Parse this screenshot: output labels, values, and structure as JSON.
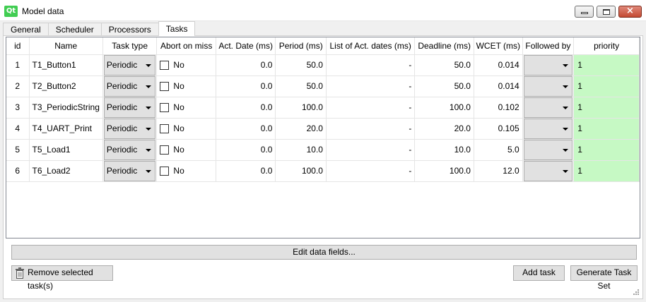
{
  "window": {
    "title": "Model data",
    "logo_text": "Qt",
    "close_glyph": "×"
  },
  "tabs": [
    {
      "label": "General"
    },
    {
      "label": "Scheduler"
    },
    {
      "label": "Processors"
    },
    {
      "label": "Tasks",
      "active": true
    }
  ],
  "table": {
    "columns": [
      "id",
      "Name",
      "Task type",
      "Abort on miss",
      "Act. Date (ms)",
      "Period (ms)",
      "List of Act. dates (ms)",
      "Deadline (ms)",
      "WCET (ms)",
      "Followed by",
      "priority"
    ],
    "rows": [
      {
        "id": "1",
        "name": "T1_Button1",
        "task_type": "Periodic",
        "abort": "No",
        "act_date": "0.0",
        "period": "50.0",
        "act_dates": "-",
        "deadline": "50.0",
        "wcet": "0.014",
        "followed_by": "",
        "priority": "1"
      },
      {
        "id": "2",
        "name": "T2_Button2",
        "task_type": "Periodic",
        "abort": "No",
        "act_date": "0.0",
        "period": "50.0",
        "act_dates": "-",
        "deadline": "50.0",
        "wcet": "0.014",
        "followed_by": "",
        "priority": "1"
      },
      {
        "id": "3",
        "name": "T3_PeriodicString",
        "task_type": "Periodic",
        "abort": "No",
        "act_date": "0.0",
        "period": "100.0",
        "act_dates": "-",
        "deadline": "100.0",
        "wcet": "0.102",
        "followed_by": "",
        "priority": "1"
      },
      {
        "id": "4",
        "name": "T4_UART_Print",
        "task_type": "Periodic",
        "abort": "No",
        "act_date": "0.0",
        "period": "20.0",
        "act_dates": "-",
        "deadline": "20.0",
        "wcet": "0.105",
        "followed_by": "",
        "priority": "1"
      },
      {
        "id": "5",
        "name": "T5_Load1",
        "task_type": "Periodic",
        "abort": "No",
        "act_date": "0.0",
        "period": "10.0",
        "act_dates": "-",
        "deadline": "10.0",
        "wcet": "5.0",
        "followed_by": "",
        "priority": "1"
      },
      {
        "id": "6",
        "name": "T6_Load2",
        "task_type": "Periodic",
        "abort": "No",
        "act_date": "0.0",
        "period": "100.0",
        "act_dates": "-",
        "deadline": "100.0",
        "wcet": "12.0",
        "followed_by": "",
        "priority": "1"
      }
    ]
  },
  "buttons": {
    "edit_fields": "Edit data fields...",
    "remove_selected": "Remove selected task(s)",
    "add_task": "Add task",
    "generate_task_set": "Generate Task Set"
  },
  "colors": {
    "priority_bg": "#c6f9c4",
    "close_button": "#c44a32",
    "qt_logo": "#41cd52"
  },
  "icons": [
    "qt-logo-icon",
    "minimize-icon",
    "maximize-icon",
    "close-icon",
    "chevron-down-icon",
    "checkbox-icon",
    "trash-icon",
    "resize-grip-icon"
  ]
}
